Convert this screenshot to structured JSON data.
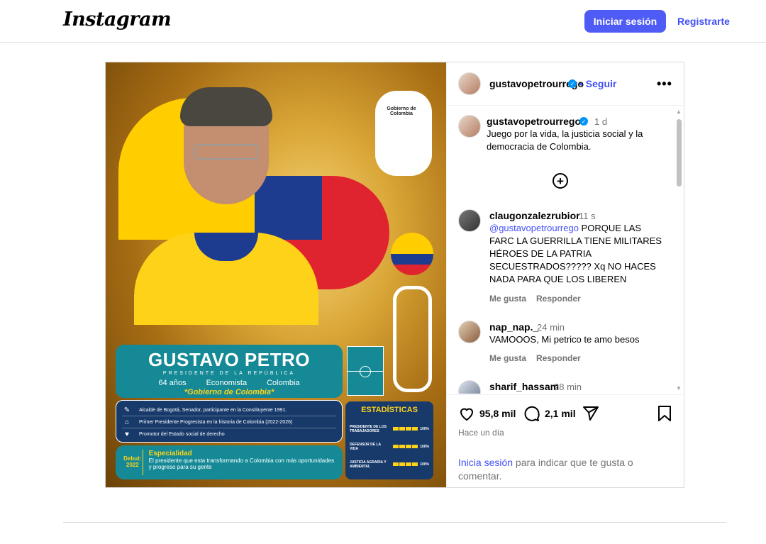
{
  "header": {
    "logo_text": "Instagram",
    "login_label": "Iniciar sesión",
    "signup_label": "Registrarte"
  },
  "post": {
    "author": "gustavopetrourrego",
    "follow_label": "• Seguir",
    "caption_time": "1 d",
    "caption": "Juego por la vida, la justicia social y la democracia de Colombia.",
    "likes": "95,8 mil",
    "comments_count": "2,1 mil",
    "date": "Hace un día",
    "login_link": "Inicia sesión",
    "login_rest": " para indicar que te gusta o comentar."
  },
  "comments": [
    {
      "user": "claugonzalezrubior",
      "time": "11 s",
      "mention": "@gustavopetrourrego",
      "text": " PORQUE LAS FARC LA GUERRILLA TIENE MILITARES HÉROES DE LA PATRIA SECUESTRADOS????? Xq NO HACES NADA PARA QUE LOS LIBEREN",
      "like_label": "Me gusta",
      "reply_label": "Responder"
    },
    {
      "user": "nap_nap._",
      "time": "24 min",
      "text": "VAMOOOS, Mi petrico te amo besos",
      "like_label": "Me gusta",
      "reply_label": "Responder"
    },
    {
      "user": "sharif_hassam",
      "time": "28 min"
    }
  ],
  "media": {
    "gov_logo": "Gobierno de Colombia",
    "name": "GUSTAVO PETRO",
    "role": "PRESIDENTE DE LA REPÚBLICA",
    "age": "64 años",
    "profession": "Economista",
    "country": "Colombia",
    "gov_tag": "*Gobierno de Colombia*",
    "bullets": [
      "Alcalde de Bogotá, Senador, participante en la Constituyente 1991.",
      "Primer Presidente Progresista en la historia de Colombia (2022-2026)",
      "Promotor del Estado social de derecho"
    ],
    "debut_label": "Debut:",
    "debut_year": "2022",
    "specialty_title": "Especialidad",
    "specialty_text": "El presidente que esta transformando a Colombia con más oportunidades y progreso para su gente",
    "stats_title": "ESTADÍSTICAS",
    "stats": [
      {
        "label": "PRESIDENTE DE LOS TRABAJADORES",
        "value": "100%"
      },
      {
        "label": "DEFENSOR DE LA VIDA",
        "value": "100%"
      },
      {
        "label": "JUSTICIA AGRARIA Y AMBIENTAL",
        "value": "100%"
      }
    ]
  },
  "icons": {
    "heart": "heart-icon",
    "comment": "comment-icon",
    "share": "share-icon",
    "save": "bookmark-icon",
    "more": "more-icon",
    "add": "plus-circle-icon"
  },
  "colors": {
    "accent": "#4f5bf5",
    "link": "#4150f7",
    "verified": "#0095f6"
  }
}
